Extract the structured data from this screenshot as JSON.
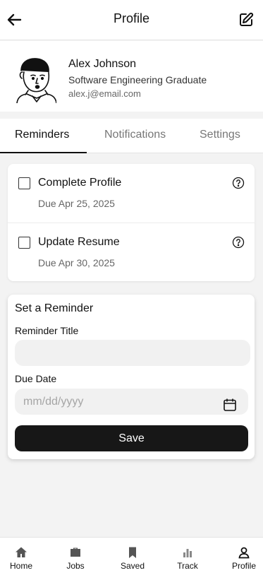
{
  "header": {
    "title": "Profile",
    "back_icon": "arrow-left-icon",
    "edit_icon": "edit-icon"
  },
  "profile": {
    "name": "Alex Johnson",
    "role": "Software Engineering Graduate",
    "email": "alex.j@email.com"
  },
  "tabs": [
    {
      "label": "Reminders",
      "active": true
    },
    {
      "label": "Notifications",
      "active": false
    },
    {
      "label": "Settings",
      "active": false
    }
  ],
  "reminders": [
    {
      "title": "Complete Profile",
      "due": "Due Apr 25, 2025",
      "checked": false
    },
    {
      "title": "Update Resume",
      "due": "Due Apr 30, 2025",
      "checked": false
    }
  ],
  "form": {
    "heading": "Set a Reminder",
    "title_label": "Reminder Title",
    "title_value": "",
    "date_label": "Due Date",
    "date_placeholder": "mm/dd/yyyy",
    "save_label": "Save"
  },
  "nav": [
    {
      "label": "Home",
      "icon": "home-icon"
    },
    {
      "label": "Jobs",
      "icon": "briefcase-icon"
    },
    {
      "label": "Saved",
      "icon": "bookmark-icon"
    },
    {
      "label": "Track",
      "icon": "bar-chart-icon"
    },
    {
      "label": "Profile",
      "icon": "user-icon"
    }
  ],
  "colors": {
    "accent": "#171717",
    "background": "#f3f3f3",
    "muted_text": "#777777"
  }
}
